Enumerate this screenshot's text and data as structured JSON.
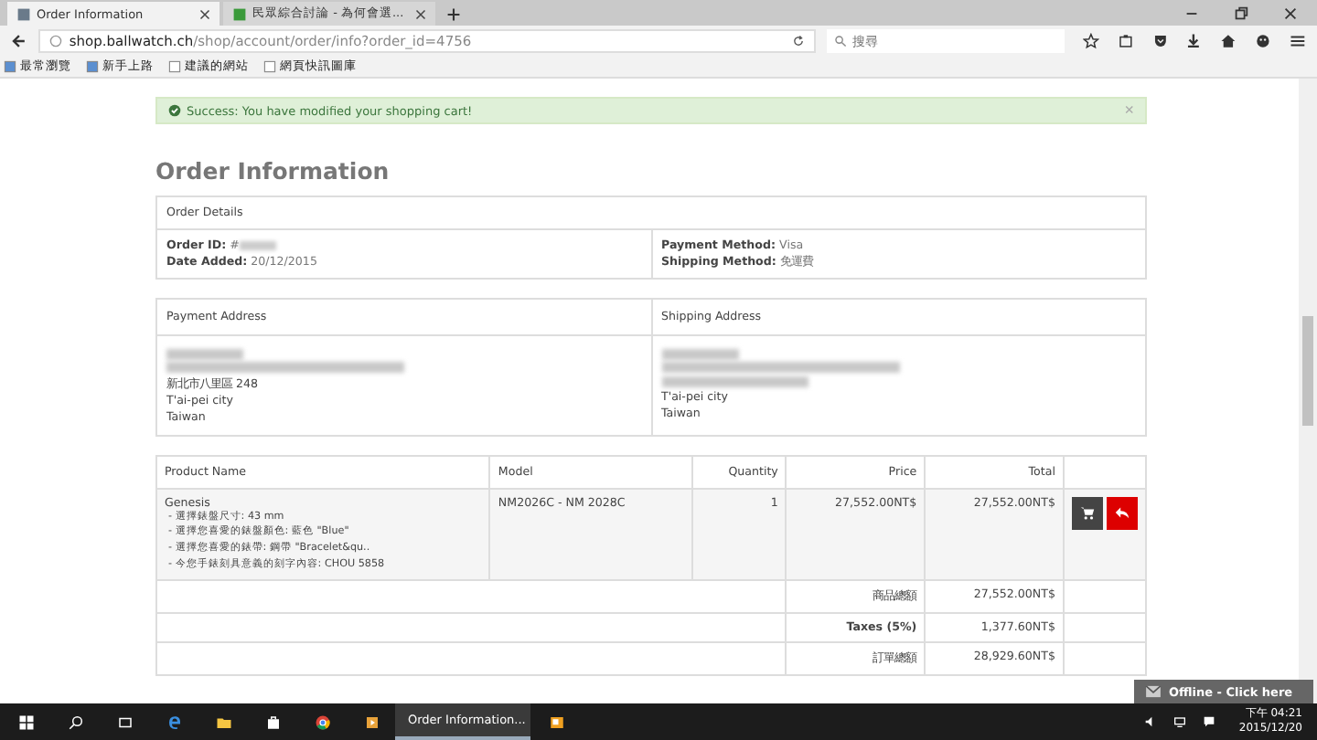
{
  "browser": {
    "tabs": [
      {
        "title": "Order Information",
        "selected": true
      },
      {
        "title": "民眾綜合討論 - 為何會選...",
        "selected": false
      }
    ],
    "url": {
      "host": "shop.ballwatch.ch",
      "path": "/shop/account/order/info?order_id=4756"
    },
    "search": {
      "placeholder": "搜尋"
    },
    "bookmarks": [
      "最常瀏覽",
      "新手上路",
      "建議的網站",
      "網頁快訊圖庫"
    ]
  },
  "alert": {
    "text": "Success: You have modified your shopping cart!",
    "close": "×"
  },
  "heading": "Order Information",
  "details": {
    "title": "Order Details",
    "left": [
      {
        "label": "Order ID:",
        "value": "#"
      },
      {
        "label": "Date Added:",
        "value": "20/12/2015"
      }
    ],
    "right": [
      {
        "label": "Payment Method:",
        "value": "Visa"
      },
      {
        "label": "Shipping Method:",
        "value": "免運費"
      }
    ]
  },
  "addresses": [
    {
      "title": "Payment Address",
      "lines": [
        "新北市八里區 248",
        "T'ai-pei city",
        "Taiwan"
      ]
    },
    {
      "title": "Shipping Address",
      "lines": [
        "T'ai-pei city",
        "Taiwan"
      ]
    }
  ],
  "products": {
    "columns": [
      "Product Name",
      "Model",
      "Quantity",
      "Price",
      "Total"
    ],
    "rows": [
      {
        "name": "Genesis",
        "options": [
          "- 選擇錶盤尺寸: 43 mm",
          "- 選擇您喜愛的錶盤顏色: 藍色 \"Blue\"",
          "- 選擇您喜愛的錶帶: 鋼帶 \"Bracelet&qu..",
          "- 今您手錶刻具意義的刻字內容: CHOU 5858"
        ],
        "model": "NM2026C - NM 2028C",
        "quantity": "1",
        "price": "27,552.00NT$",
        "total": "27,552.00NT$"
      }
    ],
    "totals": [
      {
        "label": "商品總額",
        "value": "27,552.00NT$",
        "bold": false
      },
      {
        "label": "Taxes (5%)",
        "value": "1,377.60NT$",
        "bold": true
      },
      {
        "label": "訂單總額",
        "value": "28,929.60NT$",
        "bold": false
      }
    ]
  },
  "chat": {
    "label": "Offline - Click here"
  },
  "taskbar": {
    "window": "Order Information...",
    "time": "下午 04:21",
    "date": "2015/12/20"
  }
}
